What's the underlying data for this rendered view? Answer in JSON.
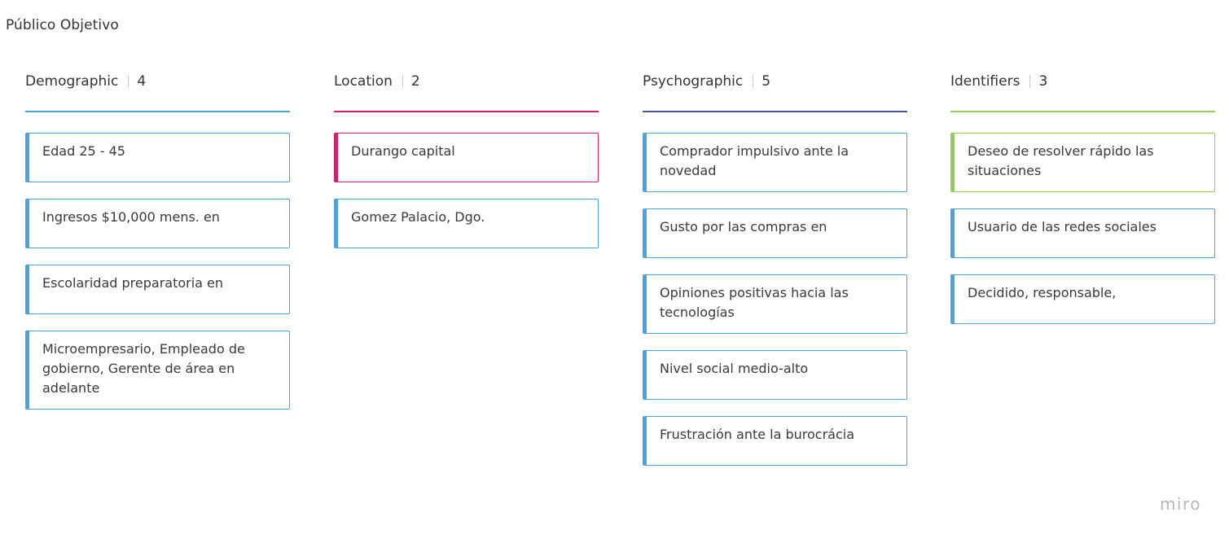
{
  "board": {
    "title": "Público Objetivo"
  },
  "columns": [
    {
      "title": "Demographic",
      "count": "4",
      "color": "#4aa3e3",
      "card_border": "#4aa3e3",
      "card_accent": "#4aa3e3",
      "cards": [
        "Edad 25 - 45",
        "Ingresos $10,000 mens. en",
        "Escolaridad preparatoria en",
        "Microempresario, Empleado de gobierno, Gerente de área en adelante"
      ]
    },
    {
      "title": "Location",
      "count": "2",
      "color": "#d1206e",
      "cards": [
        {
          "text": "Durango capital",
          "border": "#d1206e",
          "accent": "#d1206e"
        },
        {
          "text": "Gomez Palacio, Dgo.",
          "border": "#4aa3e3",
          "accent": "#4aa3e3"
        }
      ]
    },
    {
      "title": "Psychographic",
      "count": "5",
      "color": "#4a55b0",
      "card_border": "#4aa3e3",
      "card_accent": "#4aa3e3",
      "cards": [
        "Comprador impulsivo ante la novedad",
        "Gusto por las compras en",
        "Opiniones positivas hacia las tecnologías",
        "Nivel social medio-alto",
        "Frustración ante la burocrácia"
      ]
    },
    {
      "title": "Identifiers",
      "count": "3",
      "color": "#8fd14f",
      "cards": [
        {
          "text": "Deseo de resolver rápido las situaciones",
          "border": "#8fd14f",
          "accent": "#8fd14f"
        },
        {
          "text": "Usuario de las redes sociales",
          "border": "#4aa3e3",
          "accent": "#4aa3e3"
        },
        {
          "text": "Decidido, responsable,",
          "border": "#4aa3e3",
          "accent": "#4aa3e3"
        }
      ]
    }
  ],
  "footer": {
    "logo": "miro"
  }
}
